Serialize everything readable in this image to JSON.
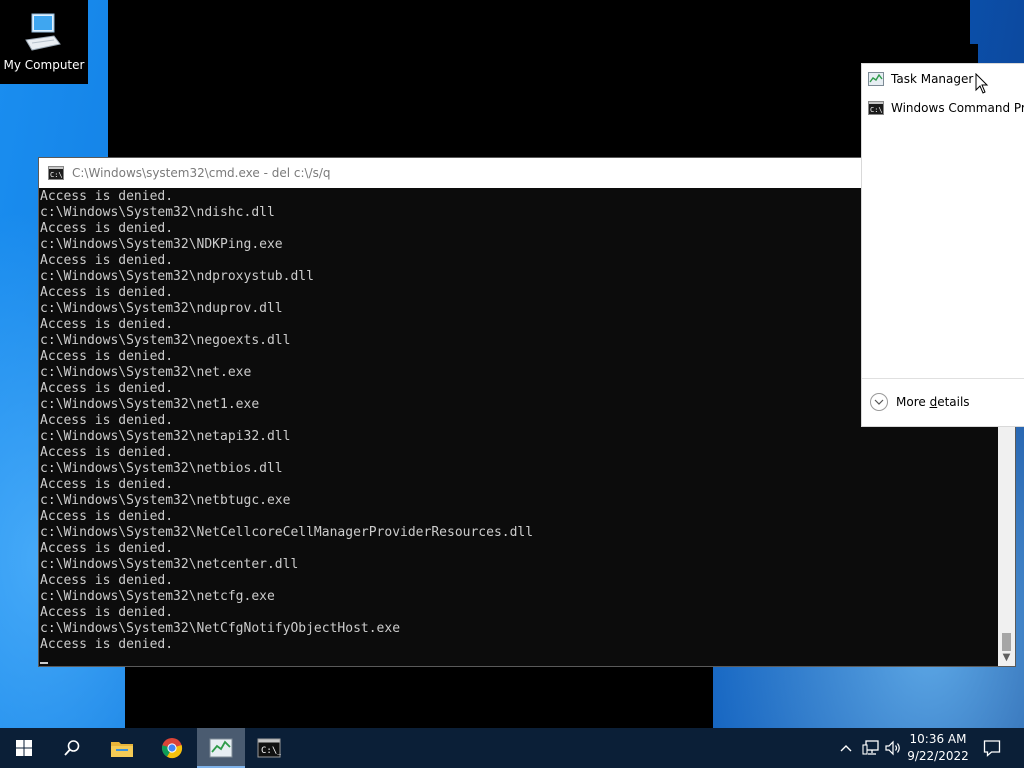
{
  "desktop": {
    "icon_label": "My Computer"
  },
  "cmd_window": {
    "title": "C:\\Windows\\system32\\cmd.exe - del  c:\\/s/q",
    "lines": [
      "Access is denied.",
      "c:\\Windows\\System32\\ndishc.dll",
      "Access is denied.",
      "c:\\Windows\\System32\\NDKPing.exe",
      "Access is denied.",
      "c:\\Windows\\System32\\ndproxystub.dll",
      "Access is denied.",
      "c:\\Windows\\System32\\nduprov.dll",
      "Access is denied.",
      "c:\\Windows\\System32\\negoexts.dll",
      "Access is denied.",
      "c:\\Windows\\System32\\net.exe",
      "Access is denied.",
      "c:\\Windows\\System32\\net1.exe",
      "Access is denied.",
      "c:\\Windows\\System32\\netapi32.dll",
      "Access is denied.",
      "c:\\Windows\\System32\\netbios.dll",
      "Access is denied.",
      "c:\\Windows\\System32\\netbtugc.exe",
      "Access is denied.",
      "c:\\Windows\\System32\\NetCellcoreCellManagerProviderResources.dll",
      "Access is denied.",
      "c:\\Windows\\System32\\netcenter.dll",
      "Access is denied.",
      "c:\\Windows\\System32\\netcfg.exe",
      "Access is denied.",
      "c:\\Windows\\System32\\NetCfgNotifyObjectHost.exe",
      "Access is denied."
    ]
  },
  "task_manager": {
    "items": [
      {
        "label": "Task Manager",
        "icon": "task-manager-icon"
      },
      {
        "label": "Windows Command Proc",
        "icon": "cmd-icon"
      }
    ],
    "more_details_prefix": "More ",
    "more_details_underlined": "d",
    "more_details_suffix": "etails"
  },
  "taskbar": {
    "buttons": [
      "start-icon",
      "search-icon",
      "file-explorer-icon",
      "chrome-icon",
      "task-manager-icon",
      "cmd-icon"
    ],
    "active_button": "task-manager-icon",
    "time": "10:36 AM",
    "date": "9/22/2022"
  },
  "colors": {
    "console_bg": "#0c0c0c",
    "console_text": "#cccccc",
    "taskbar_bg": "#0b1f37",
    "desktop_blue": "#0b6fd6"
  }
}
